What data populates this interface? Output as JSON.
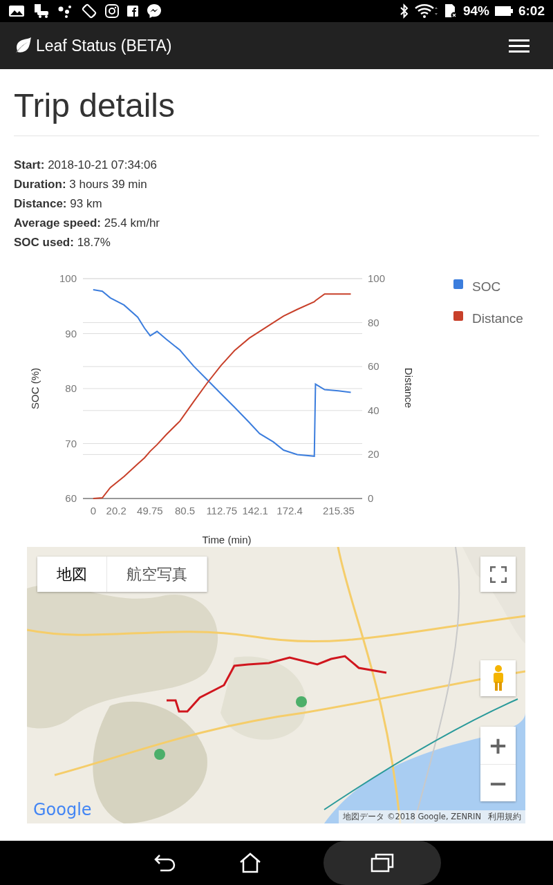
{
  "status_bar": {
    "battery": "94%",
    "time": "6:02"
  },
  "app_bar": {
    "title": "Leaf Status (BETA)"
  },
  "page": {
    "title": "Trip details"
  },
  "details": [
    {
      "label": "Start:",
      "value": "2018-10-21 07:34:06"
    },
    {
      "label": "Duration:",
      "value": "3 hours 39 min"
    },
    {
      "label": "Distance:",
      "value": "93 km"
    },
    {
      "label": "Average speed:",
      "value": "25.4 km/hr"
    },
    {
      "label": "SOC used:",
      "value": "18.7%"
    }
  ],
  "chart": {
    "chart_data": {
      "type": "line",
      "xlabel": "Time (min)",
      "ylabel": "SOC (%)",
      "y2label": "Distance",
      "x": [
        0,
        8,
        15,
        27,
        39,
        45,
        50,
        56,
        64,
        76,
        88,
        100,
        112,
        124,
        137,
        146,
        158,
        167,
        179,
        194,
        195,
        203,
        215,
        226
      ],
      "series": [
        {
          "name": "SOC",
          "color": "#3b7ddd",
          "values": [
            98,
            97.7,
            96.5,
            95.2,
            93,
            91,
            89.6,
            90.4,
            89,
            87,
            84.1,
            81.6,
            79.1,
            76.6,
            73.8,
            71.8,
            70.3,
            68.8,
            68,
            67.7,
            80.8,
            79.8,
            79.6,
            79.3
          ]
        },
        {
          "name": "Distance",
          "color": "#c8402a",
          "axis": "y2",
          "values": [
            0,
            0.3,
            5,
            10,
            15.7,
            18.5,
            21.5,
            24.5,
            29,
            35.2,
            44,
            52.5,
            60.4,
            67.3,
            73,
            76,
            80,
            83,
            86,
            89.5,
            90,
            93,
            93,
            93
          ]
        }
      ],
      "xlim": [
        -9,
        236
      ],
      "grid": true,
      "legend": "right",
      "xticks": [
        0,
        20.2,
        49.75,
        80.5,
        112.75,
        142.1,
        172.4,
        215.35
      ],
      "ylim": [
        60,
        100
      ],
      "yticks": [
        60,
        70,
        80,
        90,
        100
      ],
      "y2lim": [
        0,
        100
      ],
      "y2ticks": [
        0,
        20,
        40,
        60,
        80,
        100
      ]
    }
  },
  "map": {
    "kind": "picture",
    "tabs": [
      {
        "label": "地図",
        "selected": true
      },
      {
        "label": "航空写真",
        "selected": false
      }
    ],
    "zoom_in": "+",
    "zoom_out": "−",
    "logo": "Google",
    "attribution": "地図データ ©2018 Google, ZENRIN",
    "terms": "利用規約"
  }
}
